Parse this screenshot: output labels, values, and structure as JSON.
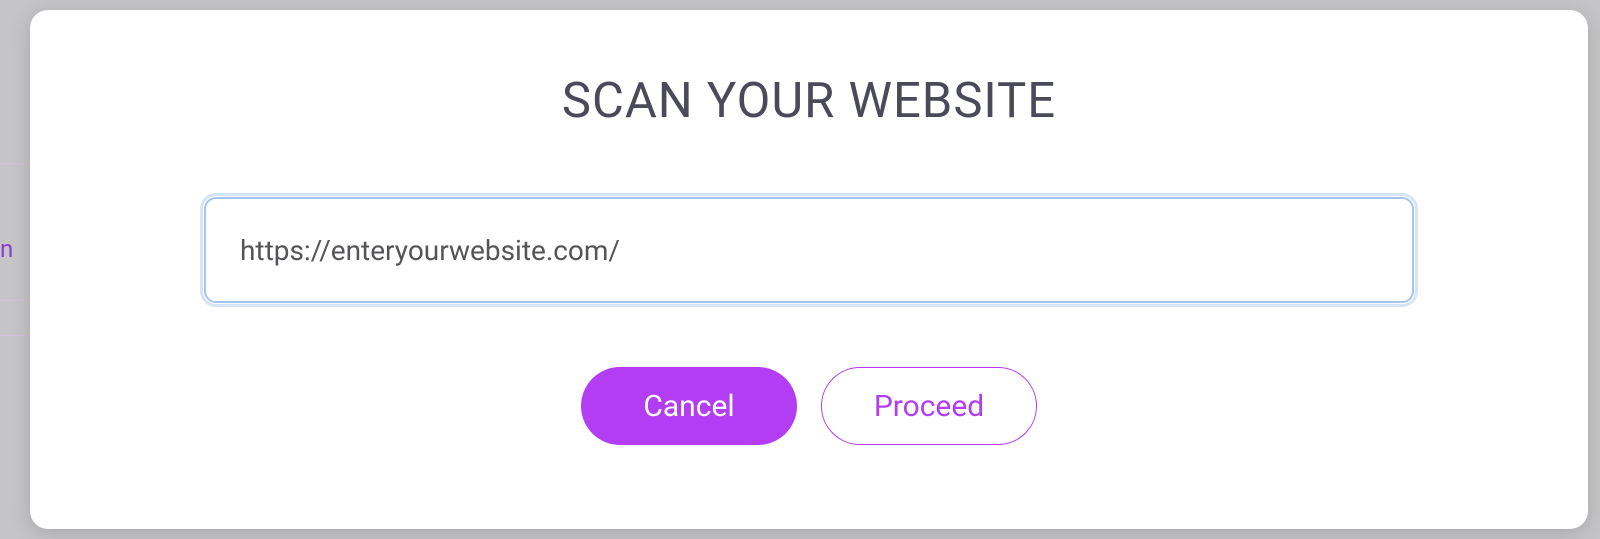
{
  "modal": {
    "title": "SCAN YOUR WEBSITE",
    "url_input_value": "https://enteryourwebsite.com/",
    "cancel_label": "Cancel",
    "proceed_label": "Proceed"
  }
}
